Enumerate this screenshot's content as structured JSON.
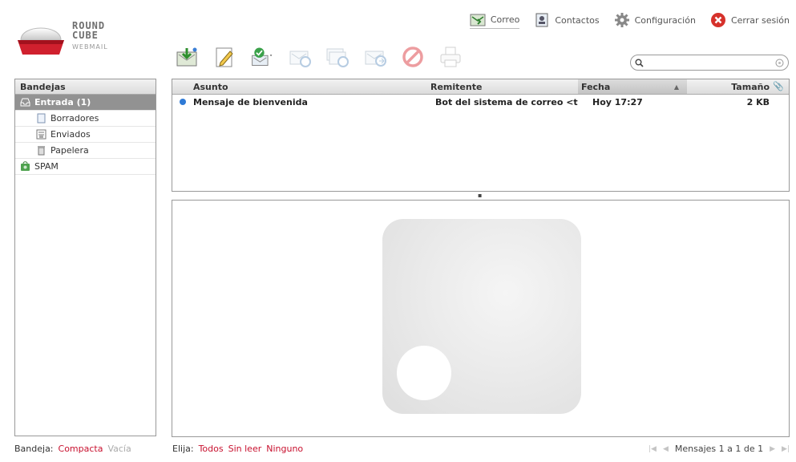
{
  "logo": {
    "line1": "ROUND",
    "line2": "CUBE",
    "line3": "WEBMAIL"
  },
  "nav": [
    {
      "label": "Correo",
      "icon": "mail-tab-icon"
    },
    {
      "label": "Contactos",
      "icon": "address-book-icon"
    },
    {
      "label": "Configuración",
      "icon": "gear-icon"
    },
    {
      "label": "Cerrar sesión",
      "icon": "logout-icon"
    }
  ],
  "toolbar": [
    {
      "action": "check-mail",
      "icon": "check-mail-icon",
      "enabled": true
    },
    {
      "action": "compose",
      "icon": "compose-icon",
      "enabled": true
    },
    {
      "action": "mark",
      "icon": "mark-icon",
      "enabled": true
    },
    {
      "action": "reply",
      "icon": "reply-icon",
      "enabled": false
    },
    {
      "action": "reply-all",
      "icon": "reply-all-icon",
      "enabled": false
    },
    {
      "action": "forward",
      "icon": "forward-icon",
      "enabled": false
    },
    {
      "action": "delete",
      "icon": "delete-icon",
      "enabled": false
    },
    {
      "action": "print",
      "icon": "print-icon",
      "enabled": false
    }
  ],
  "search": {
    "value": "",
    "placeholder": ""
  },
  "folders": {
    "title": "Bandejas",
    "items": [
      {
        "label": "Entrada (1)",
        "icon": "inbox-icon",
        "selected": true,
        "sub": false
      },
      {
        "label": "Borradores",
        "icon": "drafts-icon",
        "selected": false,
        "sub": true
      },
      {
        "label": "Enviados",
        "icon": "sent-icon",
        "selected": false,
        "sub": true
      },
      {
        "label": "Papelera",
        "icon": "trash-icon",
        "selected": false,
        "sub": true
      },
      {
        "label": "SPAM",
        "icon": "spam-icon",
        "selected": false,
        "sub": false
      }
    ]
  },
  "messages": {
    "columns": {
      "subject": "Asunto",
      "from": "Remitente",
      "date": "Fecha",
      "size": "Tamaño"
    },
    "rows": [
      {
        "subject": "Mensaje de bienvenida",
        "from": "Bot del sistema de correo <t",
        "date": "Hoy 17:27",
        "size": "2 KB",
        "unread": true
      }
    ]
  },
  "footer": {
    "folder_label": "Bandeja:",
    "compact": "Compacta",
    "empty": "Vacía",
    "select_label": "Elija:",
    "select_all": "Todos",
    "select_unread": "Sin leer",
    "select_none": "Ninguno",
    "count": "Mensajes 1 a 1 de 1"
  },
  "colors": {
    "accent": "#c8102e",
    "selected_folder": "#929292",
    "unread_dot": "#2f7ad6"
  }
}
